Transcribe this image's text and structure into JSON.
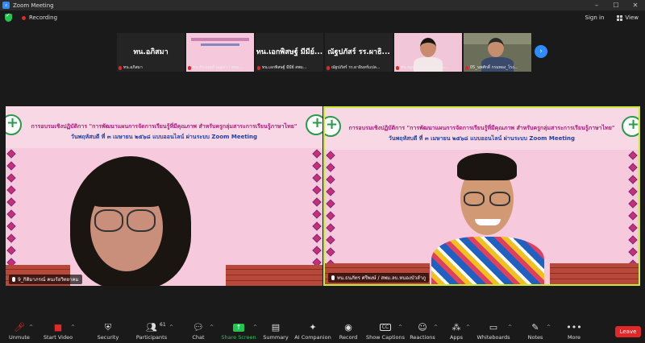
{
  "window": {
    "app_title": "Zoom Meeting",
    "minimize": "–",
    "maximize": "☐",
    "close": "✕"
  },
  "topbar": {
    "recording": "Recording",
    "sign_in": "Sign in",
    "view": "View"
  },
  "thumbnails": [
    {
      "big_name": "ทน.อภิสมา",
      "caption": "ทน.อภิสมา",
      "style": "name"
    },
    {
      "big_name": "",
      "caption": "ทน.กิรานุนท์ บุญเงา / สพม...",
      "style": "slide"
    },
    {
      "big_name": "ทน.เอกพิสษฐ์ มีมีย์...",
      "caption": "ทน.เอกพิสษฐ์ มีมีย์ สพม...",
      "style": "name"
    },
    {
      "big_name": "ณัฐปภัสร์ รร.ผาธิ...",
      "caption": "ณัฐปภัสร์ รร.ผาอินทร์แปล...",
      "style": "name"
    },
    {
      "big_name": "",
      "caption": "ทน.ณุญญารุ่ง ณ.ยุง สพม...",
      "style": "woman"
    },
    {
      "big_name": "",
      "caption": "05_นพศักดิ์ กรมทอง_โรง...",
      "style": "man"
    }
  ],
  "banner": {
    "line1": "การอบรมเชิงปฏิบัติการ \"การพัฒนาแผนการจัดการเรียนรู้ที่มีคุณภาพ สำหรับครูกลุ่มสาระการเรียนรู้ภาษาไทย\"",
    "line2": "วันพฤหัสบดี ที่ ๓ เมษายน ๒๕๖๘ แบบออนไลน์ ผ่านระบบ Zoom Meeting"
  },
  "videos": {
    "left_name": "9_กิติมาภรณ์ คนเร้อวิทยาคม",
    "right_name": "ทน.ธนภัทร ศรีพงษ์ / สพม.ลบ.หนองบัวลำภู"
  },
  "toolbar": {
    "unmute": "Unmute",
    "start_video": "Start Video",
    "security": "Security",
    "participants": "Participants",
    "participants_count": "61",
    "chat": "Chat",
    "share_screen": "Share Screen",
    "summary": "Summary",
    "ai_companion": "AI Companion",
    "record": "Record",
    "show_captions": "Show Captions",
    "reactions": "Reactions",
    "apps": "Apps",
    "whiteboards": "Whiteboards",
    "notes": "Notes",
    "more": "More",
    "leave": "Leave"
  },
  "colors": {
    "zoom_blue": "#2d8cff",
    "share_green": "#23c552",
    "leave_red": "#e02828",
    "active_speaker": "#c8e83a"
  }
}
